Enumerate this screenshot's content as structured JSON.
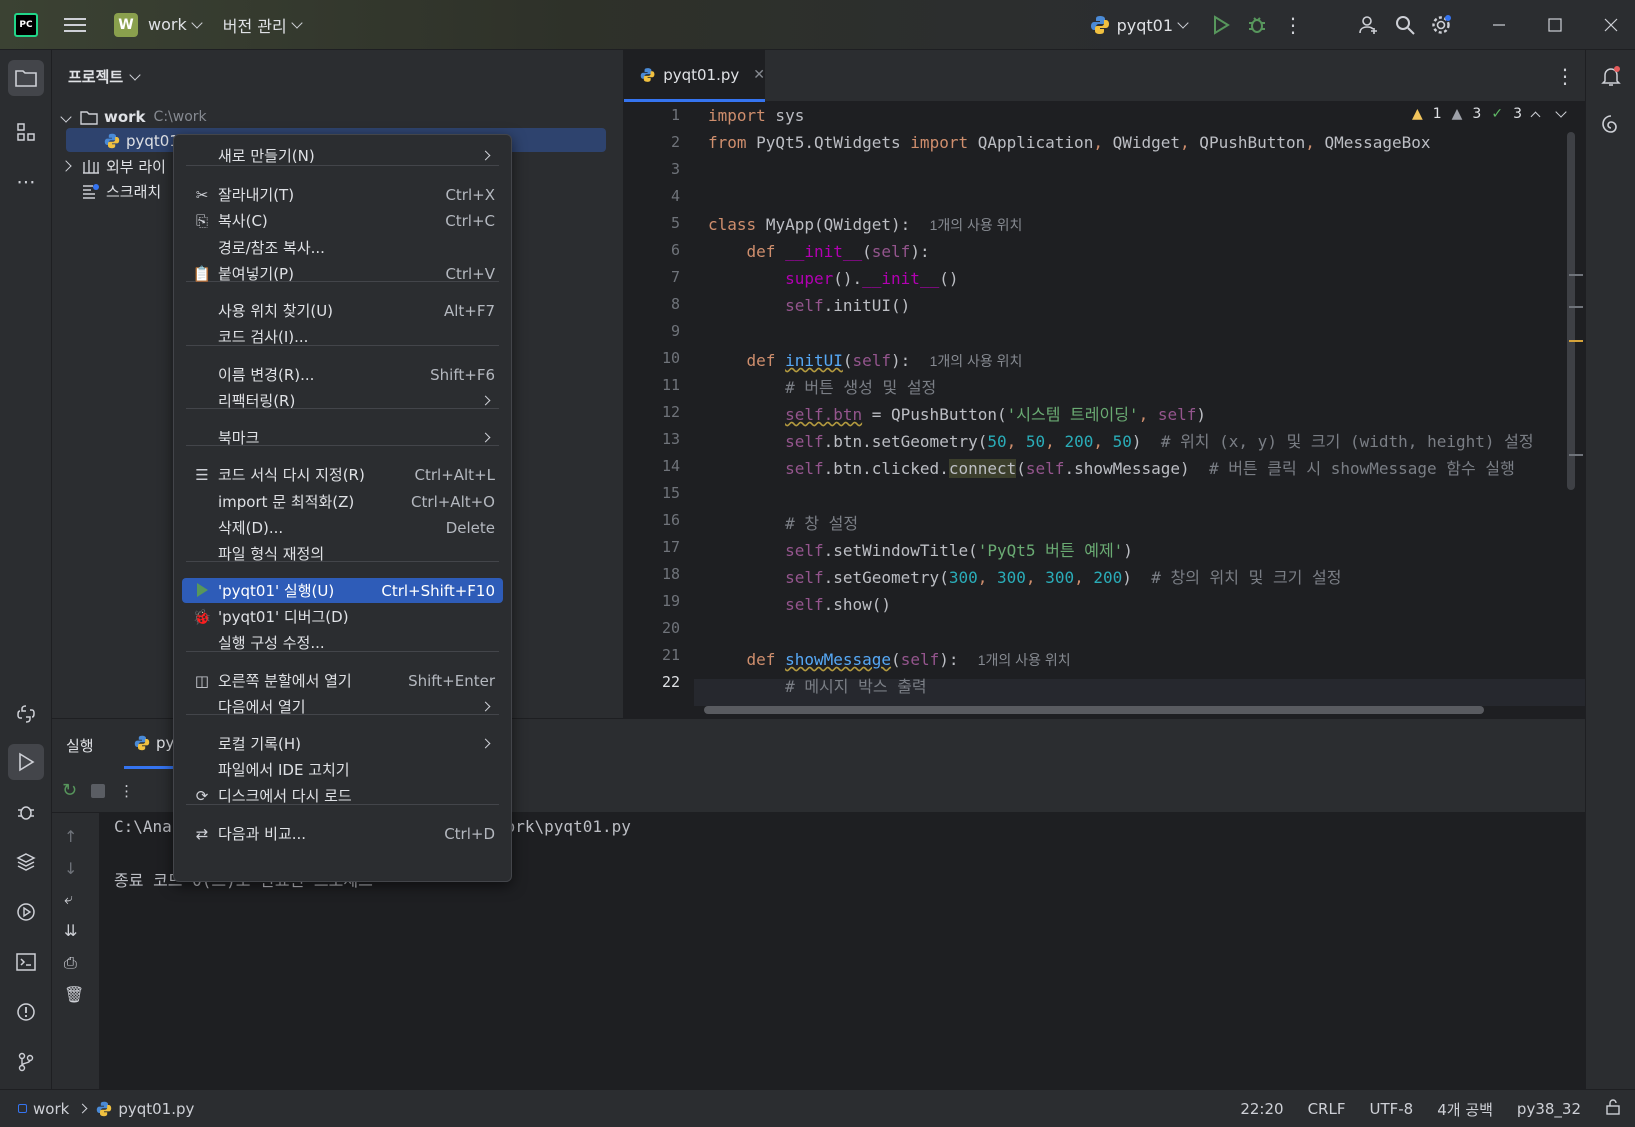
{
  "titlebar": {
    "logo": "PC",
    "project_badge": "W",
    "project_name": "work",
    "vcs_label": "버전 관리",
    "run_config": "pyqt01"
  },
  "project_panel": {
    "title": "프로젝트",
    "root_name": "work",
    "root_path": "C:\\work",
    "file": "pyqt01",
    "external_libs": "외부 라이",
    "scratches": "스크래치"
  },
  "editor": {
    "tab": "pyqt01.py",
    "indicators": {
      "warn": "1",
      "weak": "3",
      "ok": "3"
    },
    "current_line": "22",
    "line_numbers": [
      "1",
      "2",
      "3",
      "4",
      "5",
      "6",
      "7",
      "8",
      "9",
      "10",
      "11",
      "12",
      "13",
      "14",
      "15",
      "16",
      "17",
      "18",
      "19",
      "20",
      "21",
      "22"
    ],
    "hint_usage": "1개의 사용 위치"
  },
  "bottom": {
    "title": "실행",
    "tab": "py",
    "console_line1": "C:\\Ana",
    "console_line1b": "work\\pyqt01.py",
    "console_line2": "종료 코드 0(으)로 완료된 프로세스"
  },
  "status": {
    "crumb_root": "work",
    "crumb_file": "pyqt01.py",
    "position": "22:20",
    "line_sep": "CRLF",
    "encoding": "UTF-8",
    "indent": "4개 공백",
    "interpreter": "py38_32"
  },
  "menu": {
    "items": [
      {
        "label": "새로 만들기(N)",
        "shortcut": ""
      },
      {
        "label": "잘라내기(T)",
        "shortcut": "Ctrl+X"
      },
      {
        "label": "복사(C)",
        "shortcut": "Ctrl+C"
      },
      {
        "label": "경로/참조 복사...",
        "shortcut": ""
      },
      {
        "label": "붙여넣기(P)",
        "shortcut": "Ctrl+V"
      },
      {
        "label": "사용 위치 찾기(U)",
        "shortcut": "Alt+F7"
      },
      {
        "label": "코드 검사(I)...",
        "shortcut": ""
      },
      {
        "label": "이름 변경(R)...",
        "shortcut": "Shift+F6"
      },
      {
        "label": "리팩터링(R)",
        "shortcut": ""
      },
      {
        "label": "북마크",
        "shortcut": ""
      },
      {
        "label": "코드 서식 다시 지정(R)",
        "shortcut": "Ctrl+Alt+L"
      },
      {
        "label": "import 문 최적화(Z)",
        "shortcut": "Ctrl+Alt+O"
      },
      {
        "label": "삭제(D)...",
        "shortcut": "Delete"
      },
      {
        "label": "파일 형식 재정의",
        "shortcut": ""
      },
      {
        "label": "'pyqt01' 실행(U)",
        "shortcut": "Ctrl+Shift+F10"
      },
      {
        "label": "'pyqt01' 디버그(D)",
        "shortcut": ""
      },
      {
        "label": "실행 구성 수정...",
        "shortcut": ""
      },
      {
        "label": "오른쪽 분할에서 열기",
        "shortcut": "Shift+Enter"
      },
      {
        "label": "다음에서 열기",
        "shortcut": ""
      },
      {
        "label": "로컬 기록(H)",
        "shortcut": ""
      },
      {
        "label": "파일에서 IDE 고치기",
        "shortcut": ""
      },
      {
        "label": "디스크에서 다시 로드",
        "shortcut": ""
      },
      {
        "label": "다음과 비교...",
        "shortcut": "Ctrl+D"
      }
    ]
  },
  "code": {
    "l1": "import sys",
    "l2a": "from PyQt5.QtWidgets import QApplication, QWidget, QPushButton, QMessageBox",
    "l5": "MyApp(QWidget):",
    "l11": "# 버튼 생성 및 설정",
    "l12s": "'시스템 트레이딩'",
    "l13c": "# 위치 (x, y) 및 크기 (width, height) 설정",
    "l14c": "# 버튼 클릭 시 showMessage 함수 실행",
    "l16": "# 창 설정",
    "l17s": "'PyQt5 버튼 예제'",
    "l18c": "# 창의 위치 및 크기 설정",
    "l22": "# 메시지 박스 출력"
  }
}
